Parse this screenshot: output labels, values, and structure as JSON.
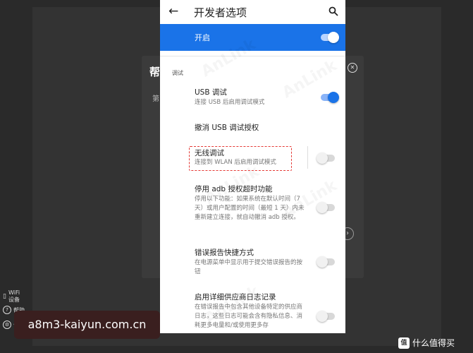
{
  "background": {
    "dialog_title": "帮",
    "dialog_sub": "第",
    "left_items": [
      {
        "icon": "wifi-icon",
        "label": "WiFi设备"
      },
      {
        "icon": "help-icon",
        "label": "帮助"
      },
      {
        "icon": "settings-icon",
        "label": "设置"
      }
    ]
  },
  "appbar": {
    "title": "开发者选项"
  },
  "master_switch": {
    "label": "开启",
    "enabled": true
  },
  "section_label": "调试",
  "items": [
    {
      "title": "USB 调试",
      "subtitle": "连接 USB 后启用调试模式",
      "toggle": "on"
    },
    {
      "title": "撤消 USB 调试授权",
      "subtitle": "",
      "toggle": "none"
    },
    {
      "title": "无线调试",
      "subtitle": "连接到 WLAN 后启用调试模式",
      "toggle": "off"
    },
    {
      "title": "停用 adb 授权超时功能",
      "subtitle": "停用以下功能：如果系统在默认时间（7 天）或用户配置的时间（最短 1 天）内未重新建立连接，就自动撤消 adb 授权。",
      "toggle": "off"
    },
    {
      "title": "错误报告快捷方式",
      "subtitle": "在电源菜单中显示用于提交错误报告的按钮",
      "toggle": "off"
    },
    {
      "title": "启用详细供应商日志记录",
      "subtitle": "在错误报告中包含其他设备特定的供应商日志，这些日志可能会含有隐私信息、消耗更多电量和/或使用更多存",
      "toggle": "off"
    }
  ],
  "watermark": "AnLink",
  "url_banner": "a8m3-kaiyun.com.cn",
  "brand": {
    "badge": "值",
    "text": "什么值得买"
  }
}
